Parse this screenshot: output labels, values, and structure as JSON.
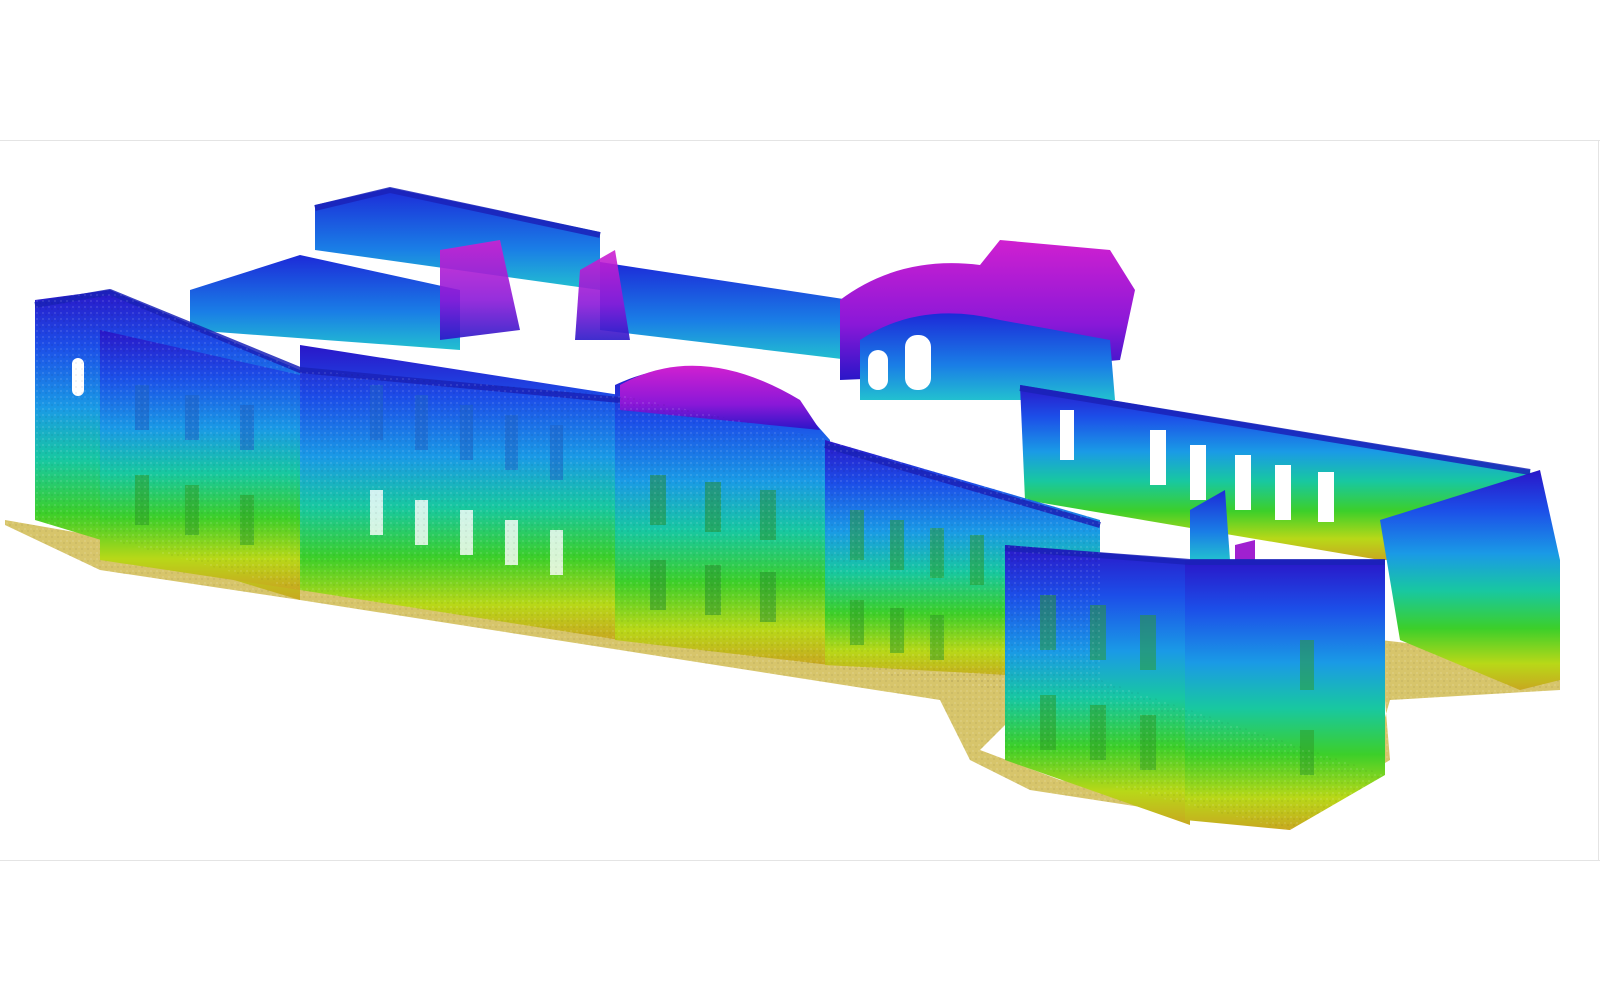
{
  "scene": {
    "colormap": [
      "#c8a820",
      "#b8d818",
      "#3ccf2a",
      "#18c8a0",
      "#1a9ae6",
      "#1c4ee8",
      "#2a16c8",
      "#8a18d8",
      "#d020d0"
    ]
  }
}
